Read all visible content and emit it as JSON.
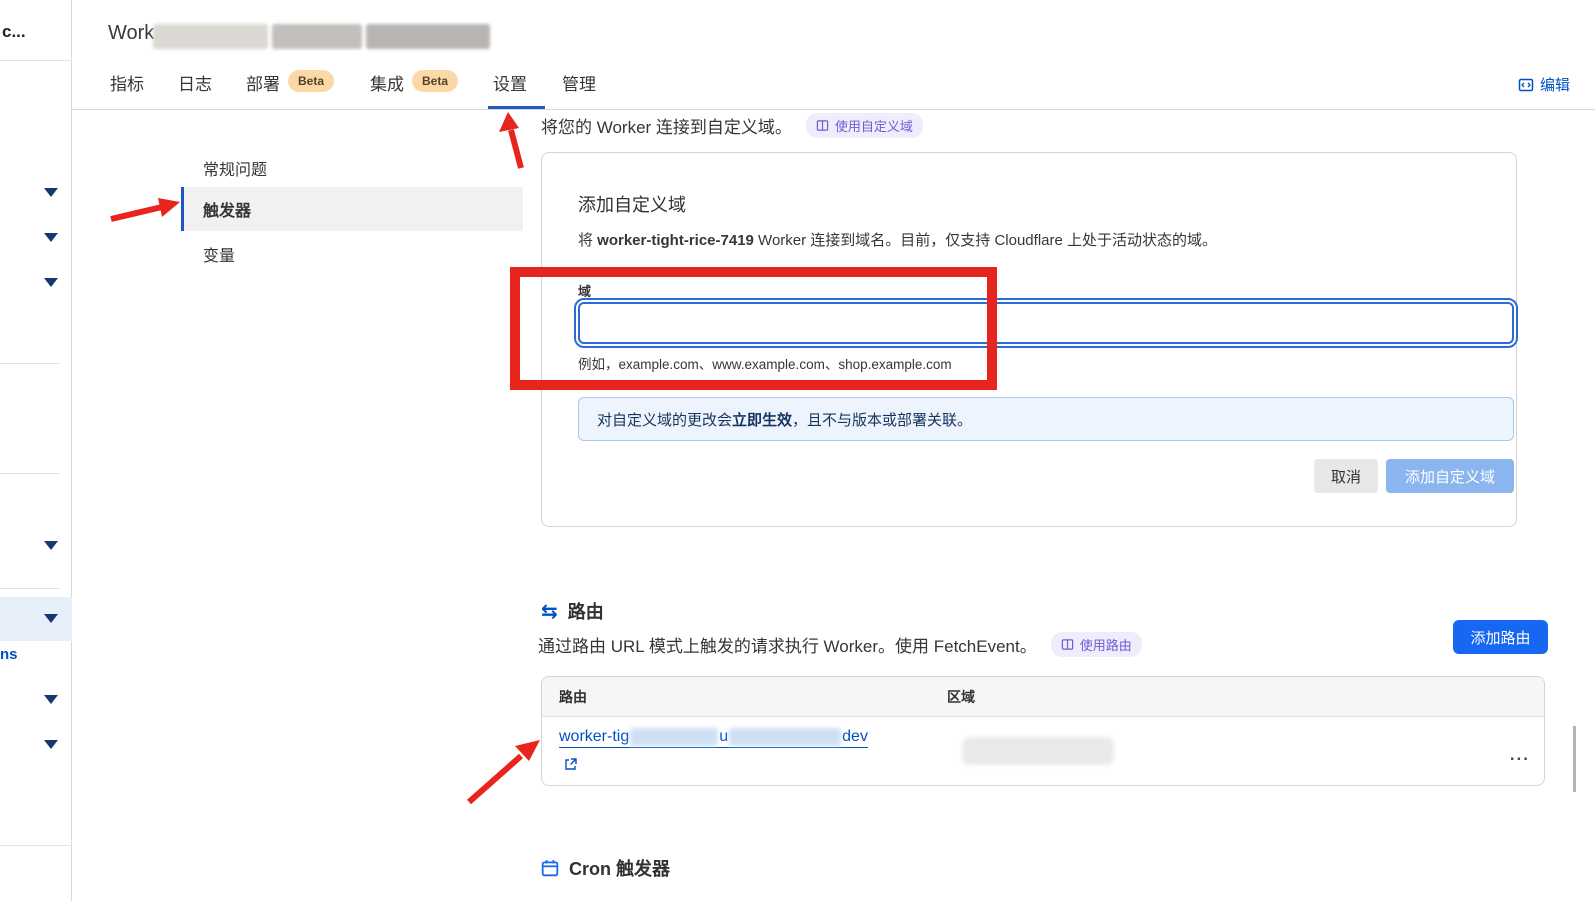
{
  "colors": {
    "link_blue": "#0051c3",
    "tab_underline": "#1e5bc6",
    "annotation_red": "#e8251d",
    "primary_button_blue": "#1667f2",
    "disabled_button_blue": "#8ab5ee",
    "beta_pill_bg": "#fbd9a6",
    "doc_badge_purple": "#6d5ed1",
    "notice_bg": "#edf4fd"
  },
  "outer_sidebar": {
    "account_label": "c...",
    "clipped_item_label": "ns"
  },
  "header": {
    "title_prefix": "Work",
    "beta_label": "Beta",
    "tabs": [
      {
        "label": "指标"
      },
      {
        "label": "日志"
      },
      {
        "label": "部署"
      },
      {
        "label": "集成"
      },
      {
        "label": "设置"
      },
      {
        "label": "管理"
      }
    ],
    "edit_link": "编辑"
  },
  "settings_nav": {
    "items": [
      {
        "label": "常规问题"
      },
      {
        "label": "触发器"
      },
      {
        "label": "变量"
      }
    ]
  },
  "custom_domain": {
    "intro": "将您的 Worker 连接到自定义域。",
    "intro_badge": "使用自定义域",
    "card_title": "添加自定义域",
    "desc_prefix": "将 ",
    "worker_name": "worker-tight-rice-7419",
    "desc_suffix": " Worker 连接到域名。目前，仅支持 Cloudflare 上处于活动状态的域。",
    "field_label": "域",
    "field_value": "",
    "helper": "例如，example.com、www.example.com、shop.example.com",
    "notice_prefix": "对自定义域的更改会",
    "notice_bold": "立即生效",
    "notice_suffix": "，且不与版本或部署关联。",
    "cancel_label": "取消",
    "submit_label": "添加自定义域"
  },
  "routes": {
    "section_title": "路由",
    "desc": "通过路由 URL 模式上触发的请求执行 Worker。使用 FetchEvent。",
    "badge": "使用路由",
    "add_button": "添加路由",
    "table": {
      "col_route": "路由",
      "col_zone": "区域",
      "row": {
        "route_prefix": "worker-tig",
        "route_mid": "u",
        "route_suffix": "dev",
        "more_label": "..."
      }
    }
  },
  "cron": {
    "title": "Cron 触发器"
  }
}
